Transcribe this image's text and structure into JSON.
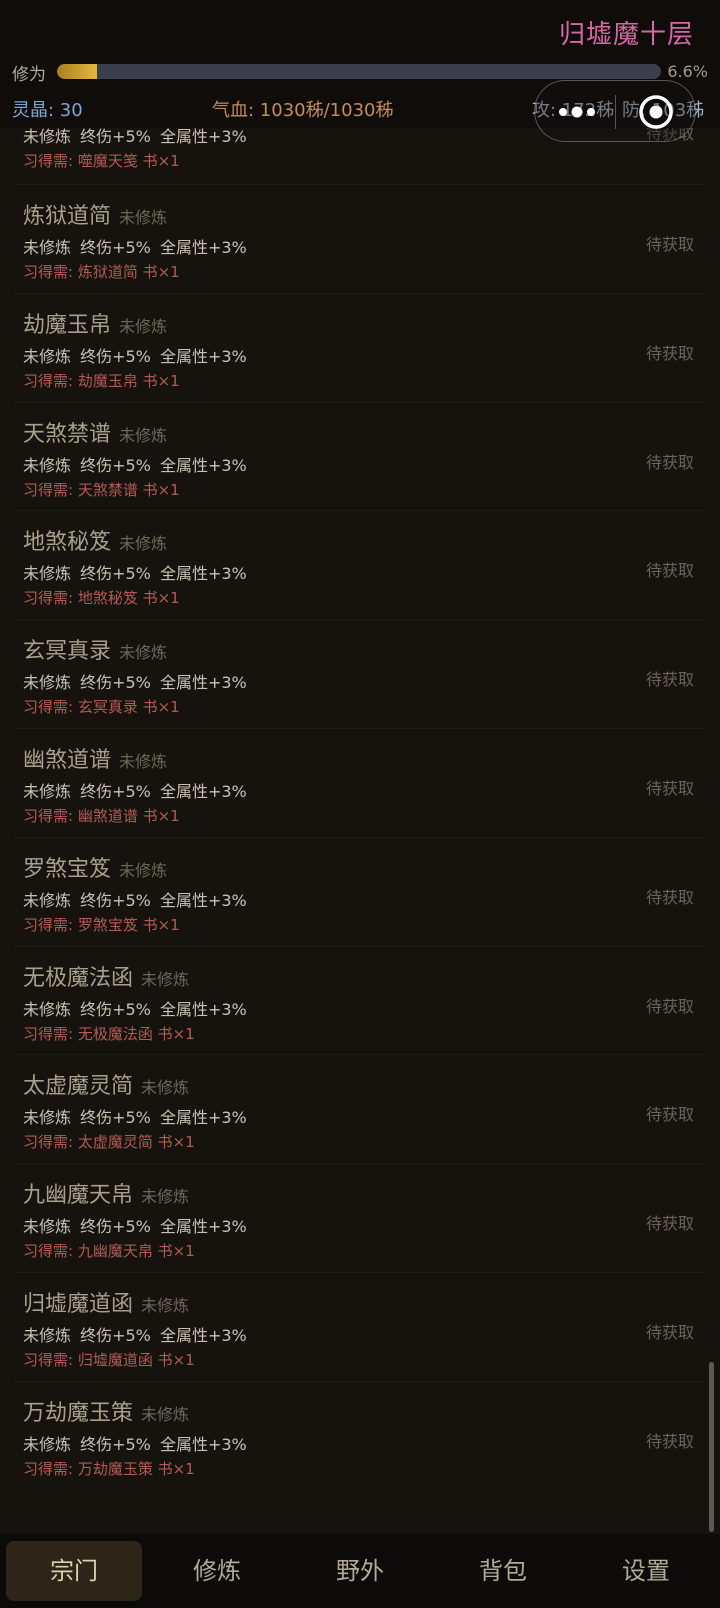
{
  "header": {
    "realm": "归墟魔十层",
    "xp_label": "修为",
    "xp_fraction": 0.066,
    "xp_percent": "6.6%",
    "crystal": "灵晶: 30",
    "hp": "气血: 1030秭/1030秭",
    "atk": "攻: 172秭",
    "def": "防: 103秭"
  },
  "partial_card": {
    "effect": "未修炼  终伤+5% 全属性+3%",
    "require": "习得需: 噬魔天笺 书×1",
    "status": "待获取"
  },
  "cards": [
    {
      "name": "炼狱道简",
      "state": "未修炼",
      "effect": "未修炼  终伤+5% 全属性+3%",
      "require": "习得需: 炼狱道简 书×1",
      "status": "待获取"
    },
    {
      "name": "劫魔玉帛",
      "state": "未修炼",
      "effect": "未修炼  终伤+5% 全属性+3%",
      "require": "习得需: 劫魔玉帛 书×1",
      "status": "待获取"
    },
    {
      "name": "天煞禁谱",
      "state": "未修炼",
      "effect": "未修炼  终伤+5% 全属性+3%",
      "require": "习得需: 天煞禁谱 书×1",
      "status": "待获取"
    },
    {
      "name": "地煞秘笈",
      "state": "未修炼",
      "effect": "未修炼  终伤+5% 全属性+3%",
      "require": "习得需: 地煞秘笈 书×1",
      "status": "待获取"
    },
    {
      "name": "玄冥真录",
      "state": "未修炼",
      "effect": "未修炼  终伤+5% 全属性+3%",
      "require": "习得需: 玄冥真录 书×1",
      "status": "待获取"
    },
    {
      "name": "幽煞道谱",
      "state": "未修炼",
      "effect": "未修炼  终伤+5% 全属性+3%",
      "require": "习得需: 幽煞道谱 书×1",
      "status": "待获取"
    },
    {
      "name": "罗煞宝笈",
      "state": "未修炼",
      "effect": "未修炼  终伤+5% 全属性+3%",
      "require": "习得需: 罗煞宝笈 书×1",
      "status": "待获取"
    },
    {
      "name": "无极魔法函",
      "state": "未修炼",
      "effect": "未修炼  终伤+5% 全属性+3%",
      "require": "习得需: 无极魔法函 书×1",
      "status": "待获取"
    },
    {
      "name": "太虚魔灵简",
      "state": "未修炼",
      "effect": "未修炼  终伤+5% 全属性+3%",
      "require": "习得需: 太虚魔灵简 书×1",
      "status": "待获取"
    },
    {
      "name": "九幽魔天帛",
      "state": "未修炼",
      "effect": "未修炼  终伤+5% 全属性+3%",
      "require": "习得需: 九幽魔天帛 书×1",
      "status": "待获取"
    },
    {
      "name": "归墟魔道函",
      "state": "未修炼",
      "effect": "未修炼  终伤+5% 全属性+3%",
      "require": "习得需: 归墟魔道函 书×1",
      "status": "待获取"
    },
    {
      "name": "万劫魔玉策",
      "state": "未修炼",
      "effect": "未修炼  终伤+5% 全属性+3%",
      "require": "习得需: 万劫魔玉策 书×1",
      "status": "待获取"
    }
  ],
  "icons": {
    "more": "more-dots-icon",
    "target": "target-icon"
  },
  "nav": [
    {
      "label": "宗门",
      "active": true
    },
    {
      "label": "修炼",
      "active": false
    },
    {
      "label": "野外",
      "active": false
    },
    {
      "label": "背包",
      "active": false
    },
    {
      "label": "设置",
      "active": false
    }
  ]
}
